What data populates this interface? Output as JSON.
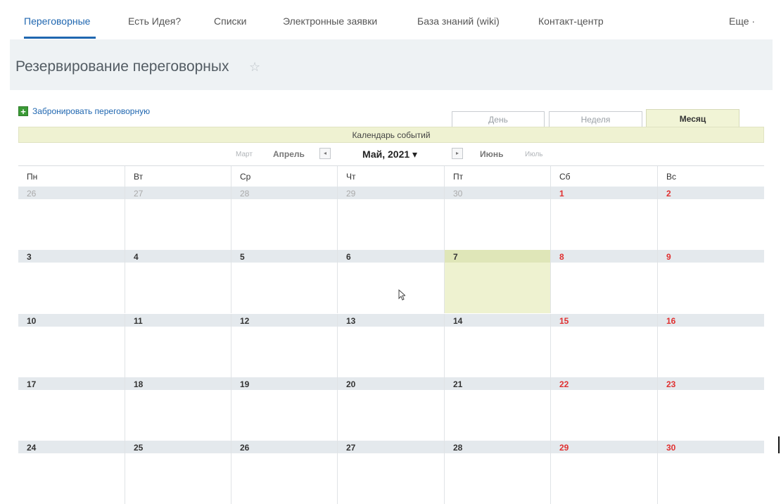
{
  "nav": {
    "items": [
      {
        "label": "Переговорные",
        "active": true
      },
      {
        "label": "Есть Идея?"
      },
      {
        "label": "Списки"
      },
      {
        "label": "Электронные заявки"
      },
      {
        "label": "База знаний (wiki)"
      },
      {
        "label": "Контакт-центр"
      }
    ],
    "more_label": "Еще ·"
  },
  "page": {
    "title": "Резервирование переговорных",
    "star": "☆"
  },
  "actions": {
    "add_label": "Забронировать переговорную",
    "add_icon": "+"
  },
  "view_tabs": [
    {
      "label": "День"
    },
    {
      "label": "Неделя"
    },
    {
      "label": "Месяц",
      "active": true
    }
  ],
  "calendar": {
    "header": "Календарь событий",
    "nav": {
      "prev2": "Март",
      "prev1": "Апрель",
      "current": "Май, 2021 ▾",
      "next1": "Июнь",
      "next2": "Июль",
      "prev_arrow": "◂",
      "next_arrow": "▸"
    },
    "weekdays": [
      "Пн",
      "Вт",
      "Ср",
      "Чт",
      "Пт",
      "Сб",
      "Вс"
    ],
    "weeks": [
      [
        {
          "day": "26",
          "other": true
        },
        {
          "day": "27",
          "other": true
        },
        {
          "day": "28",
          "other": true
        },
        {
          "day": "29",
          "other": true
        },
        {
          "day": "30",
          "other": true
        },
        {
          "day": "1",
          "weekend": true
        },
        {
          "day": "2",
          "weekend": true
        }
      ],
      [
        {
          "day": "3"
        },
        {
          "day": "4"
        },
        {
          "day": "5"
        },
        {
          "day": "6"
        },
        {
          "day": "7",
          "today": true
        },
        {
          "day": "8",
          "weekend": true
        },
        {
          "day": "9",
          "weekend": true
        }
      ],
      [
        {
          "day": "10"
        },
        {
          "day": "11"
        },
        {
          "day": "12"
        },
        {
          "day": "13"
        },
        {
          "day": "14"
        },
        {
          "day": "15",
          "weekend": true
        },
        {
          "day": "16",
          "weekend": true
        }
      ],
      [
        {
          "day": "17"
        },
        {
          "day": "18"
        },
        {
          "day": "19"
        },
        {
          "day": "20"
        },
        {
          "day": "21"
        },
        {
          "day": "22",
          "weekend": true
        },
        {
          "day": "23",
          "weekend": true
        }
      ],
      [
        {
          "day": "24"
        },
        {
          "day": "25"
        },
        {
          "day": "26"
        },
        {
          "day": "27"
        },
        {
          "day": "28"
        },
        {
          "day": "29",
          "weekend": true
        },
        {
          "day": "30",
          "weekend": true
        }
      ]
    ]
  },
  "colors": {
    "accent": "#2067b0",
    "weekend": "#e03030",
    "today_bg": "#eef2d0",
    "header_bg": "#eff2d2"
  }
}
